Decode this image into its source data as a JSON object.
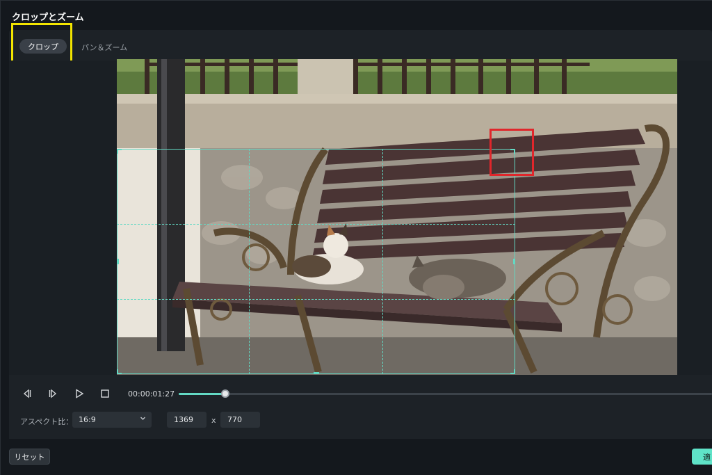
{
  "window": {
    "title": "クロップとズーム"
  },
  "tabs": [
    {
      "label": "クロップ",
      "active": true
    },
    {
      "label": "パン＆ズーム",
      "active": false
    }
  ],
  "preview": {
    "image_alt": "Two cats resting on a park bench"
  },
  "playback": {
    "timecode": "00:00:01:27",
    "progress_fraction": 0.087
  },
  "aspect": {
    "label": "アスペクト比：",
    "selected": "16:9",
    "width": "1369",
    "separator": "x",
    "height": "770"
  },
  "footer": {
    "reset_label": "リセット",
    "apply_label": "適"
  },
  "icons": [
    "prev-frame-icon",
    "next-frame-icon",
    "play-icon",
    "stop-icon",
    "chevron-down-icon"
  ],
  "colors": {
    "accent": "#63d9c4",
    "highlight_yellow": "#f3e500",
    "highlight_red": "#e0262b"
  }
}
